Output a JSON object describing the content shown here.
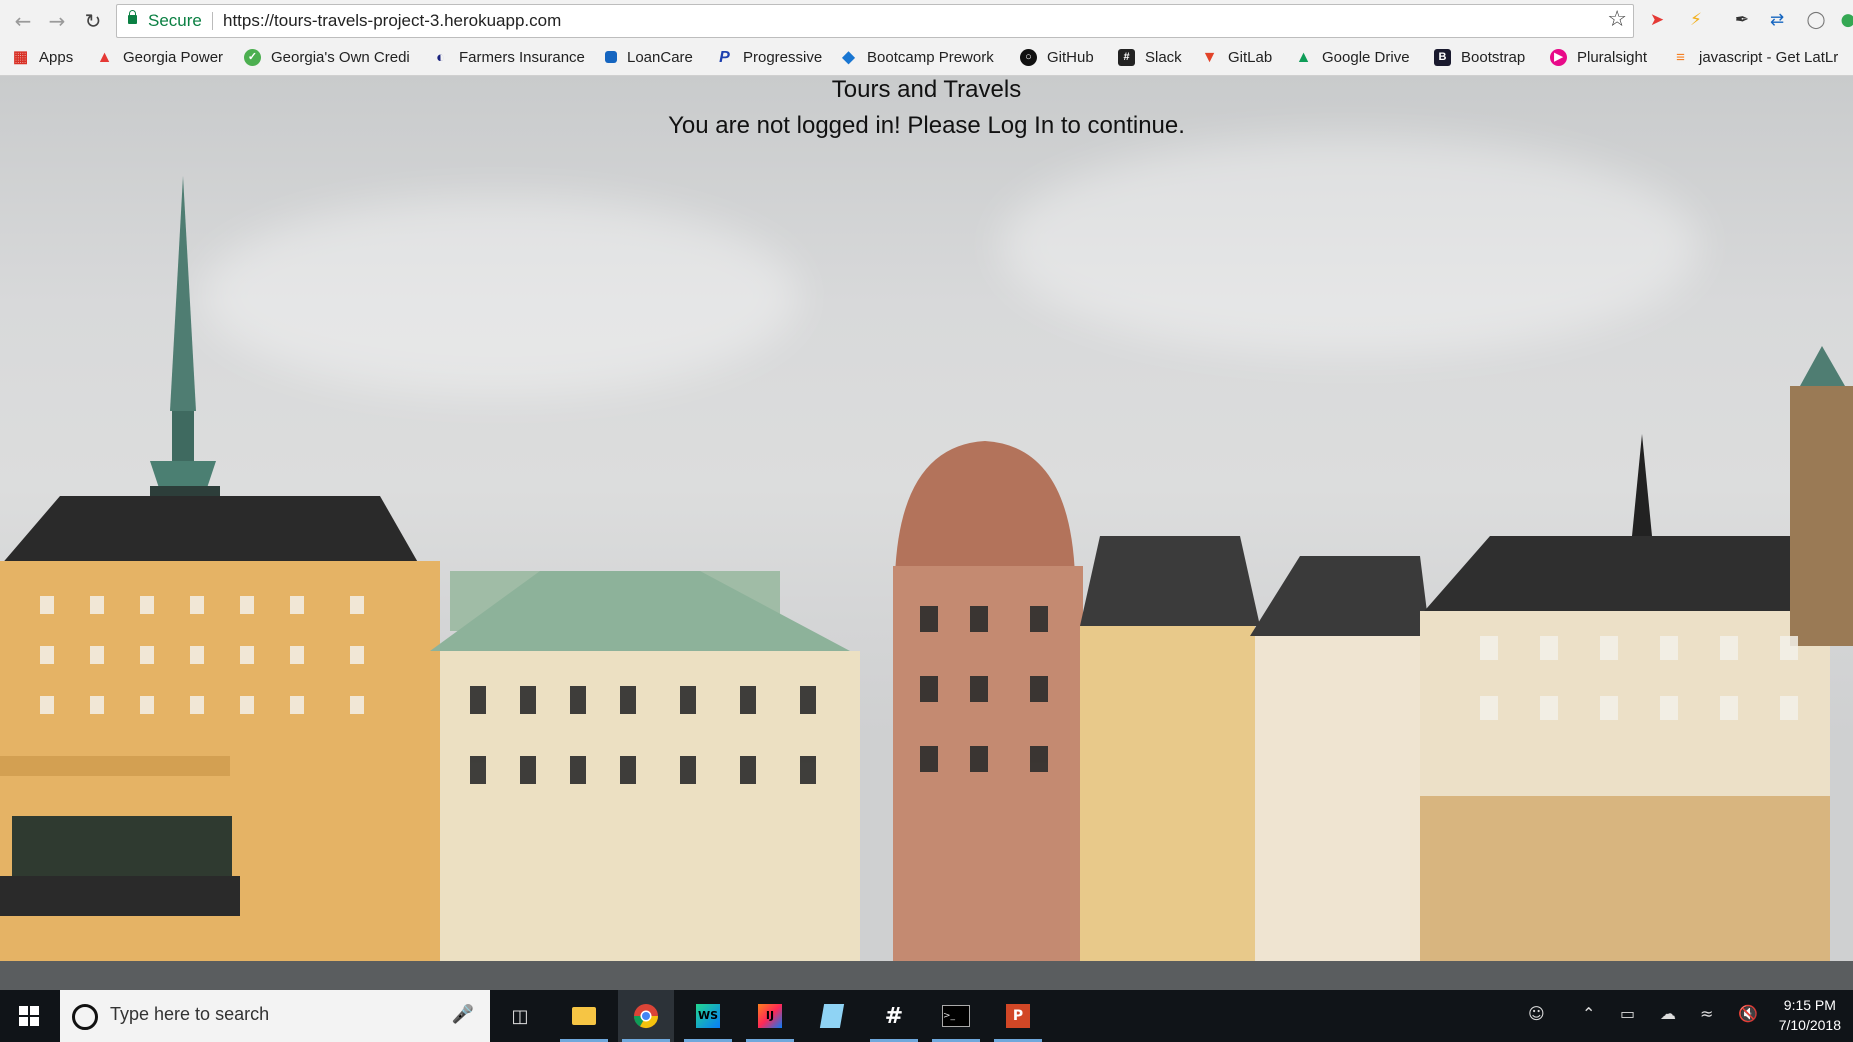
{
  "browser": {
    "secure_label": "Secure",
    "url": "https://tours-travels-project-3.herokuapp.com",
    "bookmarks": [
      {
        "label": "Apps",
        "icon": "apps-grid-icon",
        "color": "#d93025"
      },
      {
        "label": "Georgia Power",
        "icon": "georgia-power-icon",
        "color": "#e53935"
      },
      {
        "label": "Georgia's Own Credi",
        "icon": "georgias-own-icon",
        "color": "#4caf50"
      },
      {
        "label": "Farmers Insurance",
        "icon": "farmers-icon",
        "color": "#1a237e"
      },
      {
        "label": "LoanCare",
        "icon": "loancare-icon",
        "color": "#1565c0"
      },
      {
        "label": "Progressive",
        "icon": "progressive-icon",
        "color": "#1e40af"
      },
      {
        "label": "Bootcamp Prework",
        "icon": "bootcamp-icon",
        "color": "#1976d2"
      },
      {
        "label": "GitHub",
        "icon": "github-icon",
        "color": "#111111"
      },
      {
        "label": "Slack",
        "icon": "slack-icon",
        "color": "#222222"
      },
      {
        "label": "GitLab",
        "icon": "gitlab-icon",
        "color": "#e24329"
      },
      {
        "label": "Google Drive",
        "icon": "google-drive-icon",
        "color": "#0f9d58"
      },
      {
        "label": "Bootstrap",
        "icon": "bootstrap-icon",
        "color": "#1a1a2e"
      },
      {
        "label": "Pluralsight",
        "icon": "pluralsight-icon",
        "color": "#e80a89"
      },
      {
        "label": "javascript - Get LatLr",
        "icon": "stackoverflow-icon",
        "color": "#f48024"
      }
    ]
  },
  "page": {
    "title": "Tours and Travels",
    "message": "You are not logged in! Please Log In to continue."
  },
  "taskbar": {
    "search_placeholder": "Type here to search",
    "apps": [
      "task-view-icon",
      "file-explorer-icon",
      "chrome-icon",
      "webstorm-icon",
      "intellij-icon",
      "notepad-icon",
      "slack-icon",
      "terminal-icon",
      "powerpoint-icon"
    ],
    "time": "9:15 PM",
    "date": "7/10/2018"
  }
}
